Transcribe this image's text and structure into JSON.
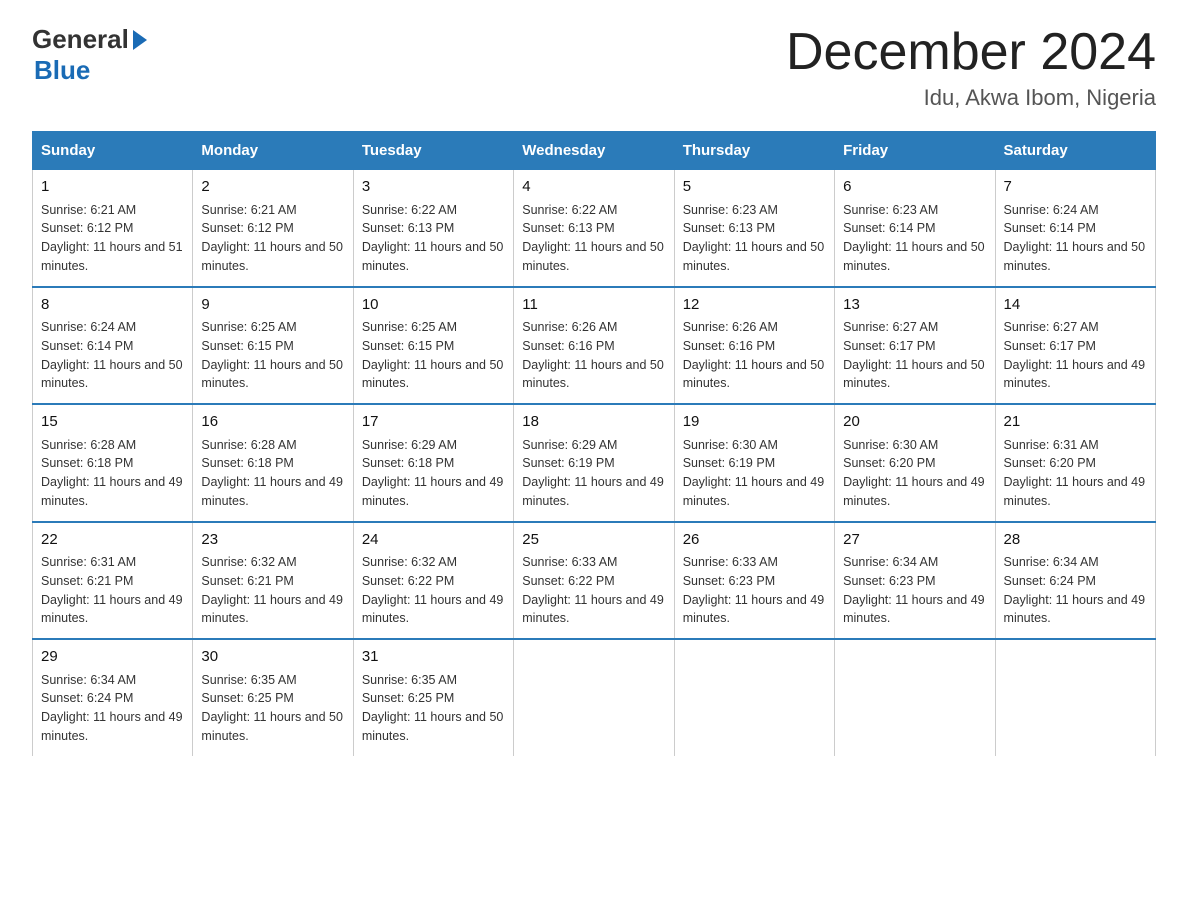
{
  "logo": {
    "general": "General",
    "blue": "Blue"
  },
  "title": "December 2024",
  "location": "Idu, Akwa Ibom, Nigeria",
  "days_of_week": [
    "Sunday",
    "Monday",
    "Tuesday",
    "Wednesday",
    "Thursday",
    "Friday",
    "Saturday"
  ],
  "weeks": [
    [
      {
        "day": "1",
        "sunrise": "6:21 AM",
        "sunset": "6:12 PM",
        "daylight": "11 hours and 51 minutes."
      },
      {
        "day": "2",
        "sunrise": "6:21 AM",
        "sunset": "6:12 PM",
        "daylight": "11 hours and 50 minutes."
      },
      {
        "day": "3",
        "sunrise": "6:22 AM",
        "sunset": "6:13 PM",
        "daylight": "11 hours and 50 minutes."
      },
      {
        "day": "4",
        "sunrise": "6:22 AM",
        "sunset": "6:13 PM",
        "daylight": "11 hours and 50 minutes."
      },
      {
        "day": "5",
        "sunrise": "6:23 AM",
        "sunset": "6:13 PM",
        "daylight": "11 hours and 50 minutes."
      },
      {
        "day": "6",
        "sunrise": "6:23 AM",
        "sunset": "6:14 PM",
        "daylight": "11 hours and 50 minutes."
      },
      {
        "day": "7",
        "sunrise": "6:24 AM",
        "sunset": "6:14 PM",
        "daylight": "11 hours and 50 minutes."
      }
    ],
    [
      {
        "day": "8",
        "sunrise": "6:24 AM",
        "sunset": "6:14 PM",
        "daylight": "11 hours and 50 minutes."
      },
      {
        "day": "9",
        "sunrise": "6:25 AM",
        "sunset": "6:15 PM",
        "daylight": "11 hours and 50 minutes."
      },
      {
        "day": "10",
        "sunrise": "6:25 AM",
        "sunset": "6:15 PM",
        "daylight": "11 hours and 50 minutes."
      },
      {
        "day": "11",
        "sunrise": "6:26 AM",
        "sunset": "6:16 PM",
        "daylight": "11 hours and 50 minutes."
      },
      {
        "day": "12",
        "sunrise": "6:26 AM",
        "sunset": "6:16 PM",
        "daylight": "11 hours and 50 minutes."
      },
      {
        "day": "13",
        "sunrise": "6:27 AM",
        "sunset": "6:17 PM",
        "daylight": "11 hours and 50 minutes."
      },
      {
        "day": "14",
        "sunrise": "6:27 AM",
        "sunset": "6:17 PM",
        "daylight": "11 hours and 49 minutes."
      }
    ],
    [
      {
        "day": "15",
        "sunrise": "6:28 AM",
        "sunset": "6:18 PM",
        "daylight": "11 hours and 49 minutes."
      },
      {
        "day": "16",
        "sunrise": "6:28 AM",
        "sunset": "6:18 PM",
        "daylight": "11 hours and 49 minutes."
      },
      {
        "day": "17",
        "sunrise": "6:29 AM",
        "sunset": "6:18 PM",
        "daylight": "11 hours and 49 minutes."
      },
      {
        "day": "18",
        "sunrise": "6:29 AM",
        "sunset": "6:19 PM",
        "daylight": "11 hours and 49 minutes."
      },
      {
        "day": "19",
        "sunrise": "6:30 AM",
        "sunset": "6:19 PM",
        "daylight": "11 hours and 49 minutes."
      },
      {
        "day": "20",
        "sunrise": "6:30 AM",
        "sunset": "6:20 PM",
        "daylight": "11 hours and 49 minutes."
      },
      {
        "day": "21",
        "sunrise": "6:31 AM",
        "sunset": "6:20 PM",
        "daylight": "11 hours and 49 minutes."
      }
    ],
    [
      {
        "day": "22",
        "sunrise": "6:31 AM",
        "sunset": "6:21 PM",
        "daylight": "11 hours and 49 minutes."
      },
      {
        "day": "23",
        "sunrise": "6:32 AM",
        "sunset": "6:21 PM",
        "daylight": "11 hours and 49 minutes."
      },
      {
        "day": "24",
        "sunrise": "6:32 AM",
        "sunset": "6:22 PM",
        "daylight": "11 hours and 49 minutes."
      },
      {
        "day": "25",
        "sunrise": "6:33 AM",
        "sunset": "6:22 PM",
        "daylight": "11 hours and 49 minutes."
      },
      {
        "day": "26",
        "sunrise": "6:33 AM",
        "sunset": "6:23 PM",
        "daylight": "11 hours and 49 minutes."
      },
      {
        "day": "27",
        "sunrise": "6:34 AM",
        "sunset": "6:23 PM",
        "daylight": "11 hours and 49 minutes."
      },
      {
        "day": "28",
        "sunrise": "6:34 AM",
        "sunset": "6:24 PM",
        "daylight": "11 hours and 49 minutes."
      }
    ],
    [
      {
        "day": "29",
        "sunrise": "6:34 AM",
        "sunset": "6:24 PM",
        "daylight": "11 hours and 49 minutes."
      },
      {
        "day": "30",
        "sunrise": "6:35 AM",
        "sunset": "6:25 PM",
        "daylight": "11 hours and 50 minutes."
      },
      {
        "day": "31",
        "sunrise": "6:35 AM",
        "sunset": "6:25 PM",
        "daylight": "11 hours and 50 minutes."
      },
      null,
      null,
      null,
      null
    ]
  ],
  "labels": {
    "sunrise": "Sunrise:",
    "sunset": "Sunset:",
    "daylight": "Daylight:"
  }
}
